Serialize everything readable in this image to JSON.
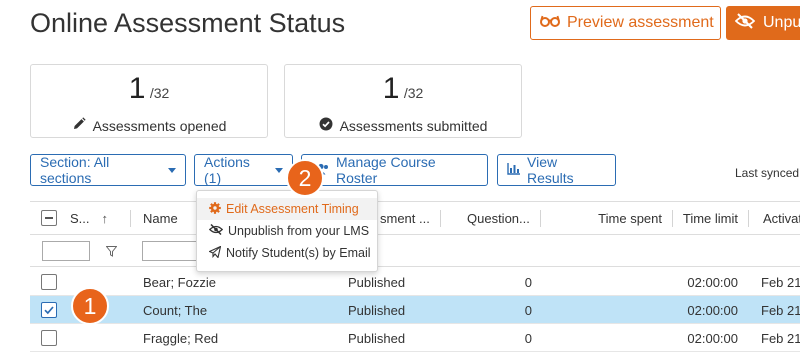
{
  "page": {
    "title": "Online Assessment Status"
  },
  "header": {
    "preview_label": "Preview assessment",
    "unpublish_label": "Unpu",
    "accent_color": "#e06a1b"
  },
  "stats": [
    {
      "value": "1",
      "denominator": "/32",
      "caption": "Assessments opened",
      "icon": "pencil-icon"
    },
    {
      "value": "1",
      "denominator": "/32",
      "caption": "Assessments submitted",
      "icon": "check-circle-icon"
    }
  ],
  "toolbar": {
    "section_label": "Section: All sections",
    "actions_label": "Actions (1)",
    "roster_label": "Manage Course Roster",
    "results_label": "View Results",
    "last_synced": "Last synced"
  },
  "actions_menu": {
    "items": [
      {
        "label": "Edit Assessment Timing",
        "icon": "gear-icon"
      },
      {
        "label": "Unpublish from your LMS",
        "icon": "eye-slash-icon"
      },
      {
        "label": "Notify Student(s) by Email",
        "icon": "paper-plane-icon"
      }
    ]
  },
  "table": {
    "columns": [
      "S...",
      "Name",
      "sment ...",
      "Question...",
      "Time spent",
      "Time limit",
      "Activat"
    ],
    "rows": [
      {
        "name": "Bear; Fozzie",
        "status": "Published",
        "questions": "0",
        "time_spent": "",
        "time_limit": "02:00:00",
        "activation": "Feb 21,",
        "selected": false
      },
      {
        "name": "Count; The",
        "status": "Published",
        "questions": "0",
        "time_spent": "",
        "time_limit": "02:00:00",
        "activation": "Feb 21,",
        "selected": true
      },
      {
        "name": "Fraggle; Red",
        "status": "Published",
        "questions": "0",
        "time_spent": "",
        "time_limit": "02:00:00",
        "activation": "Feb 21,",
        "selected": false
      }
    ]
  },
  "callouts": [
    "1",
    "2"
  ]
}
